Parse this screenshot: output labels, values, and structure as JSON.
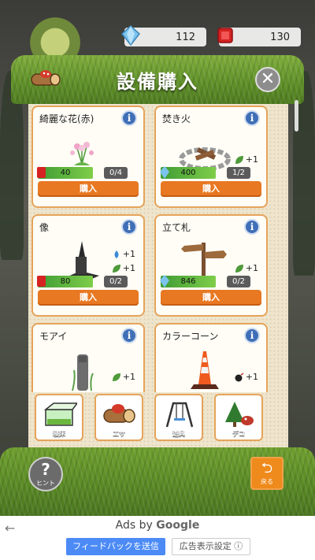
{
  "currency": {
    "diamond": "112",
    "ruby": "130"
  },
  "panel": {
    "title": "設備購入"
  },
  "items": [
    {
      "name": "綺麗な花(赤)",
      "price": "40",
      "count": "0/4",
      "buy": "購入",
      "currency": "ruby",
      "bonuses": []
    },
    {
      "name": "焚き火",
      "price": "400",
      "count": "1/2",
      "buy": "購入",
      "currency": "diamond",
      "bonuses": [
        "+1"
      ]
    },
    {
      "name": "像",
      "price": "80",
      "count": "0/2",
      "buy": "購入",
      "currency": "ruby",
      "bonuses": [
        "+1",
        "+1"
      ]
    },
    {
      "name": "立て札",
      "price": "846",
      "count": "0/2",
      "buy": "購入",
      "currency": "diamond",
      "bonuses": [
        "+1"
      ]
    },
    {
      "name": "モアイ",
      "bonuses": [
        "+1"
      ]
    },
    {
      "name": "カラーコーン",
      "bonuses": [
        "+1"
      ]
    }
  ],
  "tabs": [
    {
      "label": "寝床"
    },
    {
      "label": "エサ"
    },
    {
      "label": "遊具"
    },
    {
      "label": "デコ"
    }
  ],
  "hint": {
    "label": "ヒント",
    "glyph": "?"
  },
  "back": {
    "label": "戻る"
  },
  "ad": {
    "ads_by": "Ads by",
    "google": "Google",
    "feedback": "フィードバックを送信",
    "settings": "広告表示設定 ⓘ"
  },
  "colors": {
    "buy": "#e87822",
    "card_border": "#e6a35a",
    "price_bar": "#3f9b34",
    "info": "#3f6fb6"
  }
}
